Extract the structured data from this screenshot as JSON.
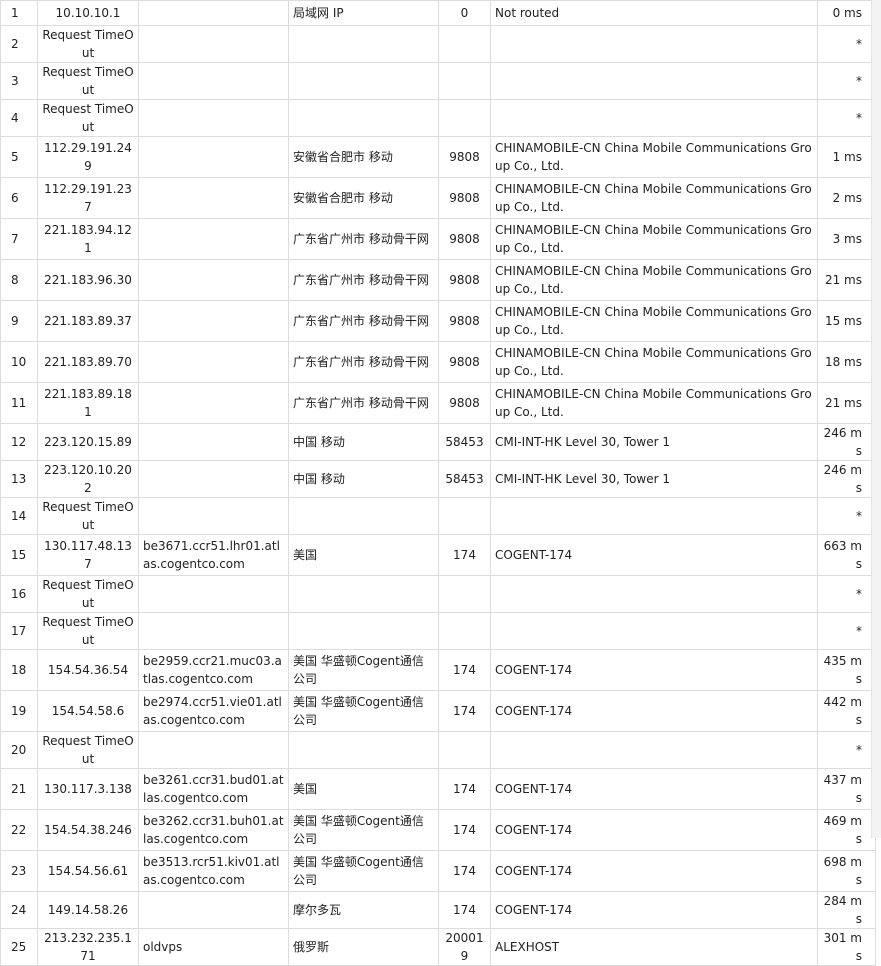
{
  "rows": [
    {
      "hop": "1",
      "ip": "10.10.10.1",
      "host": "",
      "loc": "局域网 IP",
      "asn": "0",
      "org": "Not routed",
      "time": "0 ms"
    },
    {
      "hop": "2",
      "ip": "Request TimeOut",
      "host": "",
      "loc": "",
      "asn": "",
      "org": "",
      "time": "*"
    },
    {
      "hop": "3",
      "ip": "Request TimeOut",
      "host": "",
      "loc": "",
      "asn": "",
      "org": "",
      "time": "*"
    },
    {
      "hop": "4",
      "ip": "Request TimeOut",
      "host": "",
      "loc": "",
      "asn": "",
      "org": "",
      "time": "*"
    },
    {
      "hop": "5",
      "ip": "112.29.191.249",
      "host": "",
      "loc": "安徽省合肥市 移动",
      "asn": "9808",
      "org": "CHINAMOBILE-CN China Mobile Communications Group Co., Ltd.",
      "time": "1 ms"
    },
    {
      "hop": "6",
      "ip": "112.29.191.237",
      "host": "",
      "loc": "安徽省合肥市 移动",
      "asn": "9808",
      "org": "CHINAMOBILE-CN China Mobile Communications Group Co., Ltd.",
      "time": "2 ms"
    },
    {
      "hop": "7",
      "ip": "221.183.94.121",
      "host": "",
      "loc": "广东省广州市 移动骨干网",
      "asn": "9808",
      "org": "CHINAMOBILE-CN China Mobile Communications Group Co., Ltd.",
      "time": "3 ms"
    },
    {
      "hop": "8",
      "ip": "221.183.96.30",
      "host": "",
      "loc": "广东省广州市 移动骨干网",
      "asn": "9808",
      "org": "CHINAMOBILE-CN China Mobile Communications Group Co., Ltd.",
      "time": "21 ms"
    },
    {
      "hop": "9",
      "ip": "221.183.89.37",
      "host": "",
      "loc": "广东省广州市 移动骨干网",
      "asn": "9808",
      "org": "CHINAMOBILE-CN China Mobile Communications Group Co., Ltd.",
      "time": "15 ms"
    },
    {
      "hop": "10",
      "ip": "221.183.89.70",
      "host": "",
      "loc": "广东省广州市 移动骨干网",
      "asn": "9808",
      "org": "CHINAMOBILE-CN China Mobile Communications Group Co., Ltd.",
      "time": "18 ms"
    },
    {
      "hop": "11",
      "ip": "221.183.89.181",
      "host": "",
      "loc": "广东省广州市 移动骨干网",
      "asn": "9808",
      "org": "CHINAMOBILE-CN China Mobile Communications Group Co., Ltd.",
      "time": "21 ms"
    },
    {
      "hop": "12",
      "ip": "223.120.15.89",
      "host": "",
      "loc": "中国 移动",
      "asn": "58453",
      "org": "CMI-INT-HK Level 30, Tower 1",
      "time": "246 ms"
    },
    {
      "hop": "13",
      "ip": "223.120.10.202",
      "host": "",
      "loc": "中国 移动",
      "asn": "58453",
      "org": "CMI-INT-HK Level 30, Tower 1",
      "time": "246 ms"
    },
    {
      "hop": "14",
      "ip": "Request TimeOut",
      "host": "",
      "loc": "",
      "asn": "",
      "org": "",
      "time": "*"
    },
    {
      "hop": "15",
      "ip": "130.117.48.137",
      "host": "be3671.ccr51.lhr01.atlas.cogentco.com",
      "loc": "美国",
      "asn": "174",
      "org": "COGENT-174",
      "time": "663 ms"
    },
    {
      "hop": "16",
      "ip": "Request TimeOut",
      "host": "",
      "loc": "",
      "asn": "",
      "org": "",
      "time": "*"
    },
    {
      "hop": "17",
      "ip": "Request TimeOut",
      "host": "",
      "loc": "",
      "asn": "",
      "org": "",
      "time": "*"
    },
    {
      "hop": "18",
      "ip": "154.54.36.54",
      "host": "be2959.ccr21.muc03.atlas.cogentco.com",
      "loc": "美国 华盛顿Cogent通信公司",
      "asn": "174",
      "org": "COGENT-174",
      "time": "435 ms"
    },
    {
      "hop": "19",
      "ip": "154.54.58.6",
      "host": "be2974.ccr51.vie01.atlas.cogentco.com",
      "loc": "美国 华盛顿Cogent通信公司",
      "asn": "174",
      "org": "COGENT-174",
      "time": "442 ms"
    },
    {
      "hop": "20",
      "ip": "Request TimeOut",
      "host": "",
      "loc": "",
      "asn": "",
      "org": "",
      "time": "*"
    },
    {
      "hop": "21",
      "ip": "130.117.3.138",
      "host": "be3261.ccr31.bud01.atlas.cogentco.com",
      "loc": "美国",
      "asn": "174",
      "org": "COGENT-174",
      "time": "437 ms"
    },
    {
      "hop": "22",
      "ip": "154.54.38.246",
      "host": "be3262.ccr31.buh01.atlas.cogentco.com",
      "loc": "美国 华盛顿Cogent通信公司",
      "asn": "174",
      "org": "COGENT-174",
      "time": "469 ms"
    },
    {
      "hop": "23",
      "ip": "154.54.56.61",
      "host": "be3513.rcr51.kiv01.atlas.cogentco.com",
      "loc": "美国 华盛顿Cogent通信公司",
      "asn": "174",
      "org": "COGENT-174",
      "time": "698 ms"
    },
    {
      "hop": "24",
      "ip": "149.14.58.26",
      "host": "",
      "loc": "摩尔多瓦",
      "asn": "174",
      "org": "COGENT-174",
      "time": "284 ms"
    },
    {
      "hop": "25",
      "ip": "213.232.235.171",
      "host": "oldvps",
      "loc": "俄罗斯",
      "asn": "200019",
      "org": "ALEXHOST",
      "time": "301 ms"
    }
  ]
}
